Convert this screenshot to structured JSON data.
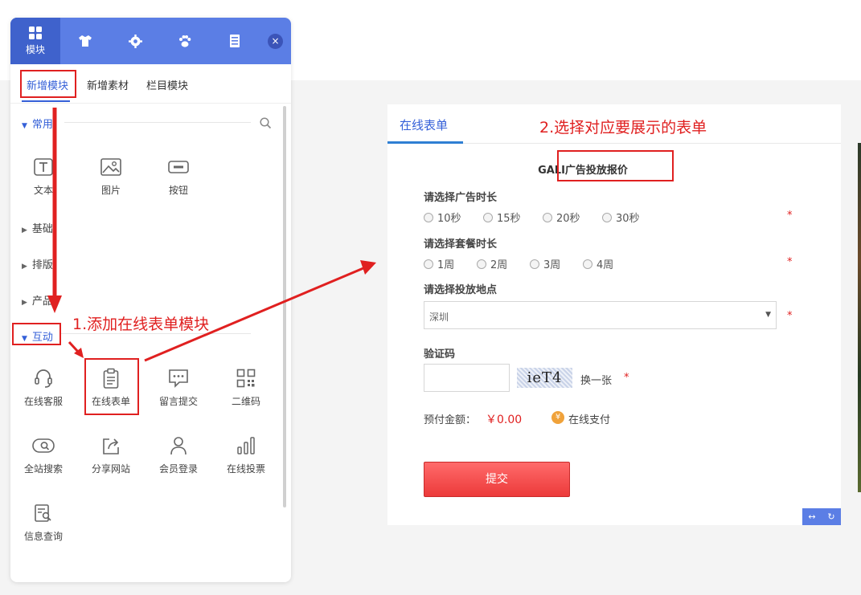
{
  "panel": {
    "top_tabs": [
      {
        "label": "模块",
        "icon": "grid-icon"
      },
      {
        "label": "",
        "icon": "tshirt-icon"
      },
      {
        "label": "",
        "icon": "gear-icon"
      },
      {
        "label": "",
        "icon": "paw-icon"
      },
      {
        "label": "",
        "icon": "server-icon"
      }
    ],
    "close_label": "×",
    "sub_tabs": [
      "新增模块",
      "新增素材",
      "栏目模块"
    ],
    "sections": {
      "common": "常用",
      "basic": "基础",
      "layout": "排版",
      "product": "产品",
      "interactive": "互动"
    },
    "common_items": [
      "文本",
      "图片",
      "按钮"
    ],
    "interactive_items": [
      "在线客服",
      "在线表单",
      "留言提交",
      "二维码",
      "全站搜索",
      "分享网站",
      "会员登录",
      "在线投票",
      "信息查询"
    ]
  },
  "annotations": {
    "step1": "1.添加在线表单模块",
    "step2": "2.选择对应要展示的表单"
  },
  "form": {
    "tab": "在线表单",
    "title": "GALI广告投放报价",
    "q1": {
      "label": "请选择广告时长",
      "options": [
        "10秒",
        "15秒",
        "20秒",
        "30秒"
      ]
    },
    "q2": {
      "label": "请选择套餐时长",
      "options": [
        "1周",
        "2周",
        "3周",
        "4周"
      ]
    },
    "q3": {
      "label": "请选择投放地点",
      "value": "深圳"
    },
    "captcha": {
      "label": "验证码",
      "image_text": "ieT4",
      "refresh": "换一张"
    },
    "required_mark": "*",
    "payment": {
      "label": "预付金额：",
      "amount": "￥0.00",
      "icon_text": "¥",
      "method": "在线支付"
    },
    "submit": "提交",
    "tools": [
      "↔",
      "↻"
    ]
  }
}
